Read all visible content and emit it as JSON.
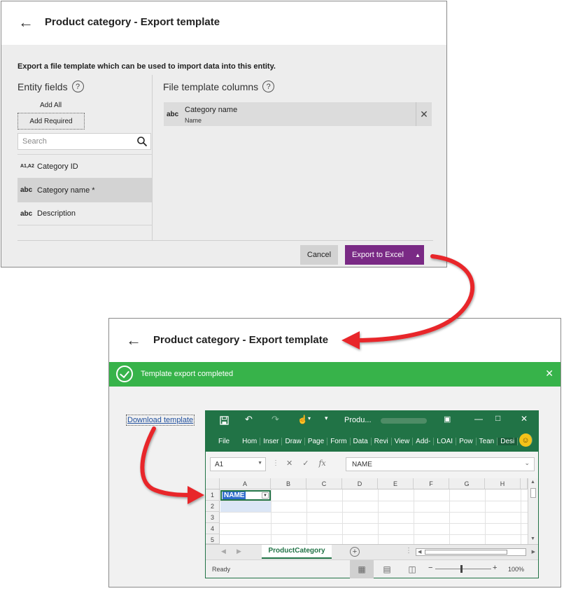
{
  "export_dialog": {
    "title": "Product category - Export template",
    "description": "Export a file template which can be used to import data into this entity.",
    "entity_fields_title": "Entity fields",
    "file_columns_title": "File template columns",
    "help_glyph": "?",
    "add_all_label": "Add All",
    "add_required_label": "Add Required",
    "search_placeholder": "Search",
    "fields": [
      {
        "icon": "A1,A2",
        "label": "Category ID"
      },
      {
        "icon": "abc",
        "label": "Category name *"
      },
      {
        "icon": "abc",
        "label": "Description"
      }
    ],
    "column": {
      "icon": "abc",
      "name": "Category name",
      "sub": "Name"
    },
    "cancel_label": "Cancel",
    "export_label": "Export to Excel"
  },
  "result_dialog": {
    "title": "Product category - Export template",
    "success_message": "Template export completed",
    "download_link": "Download template"
  },
  "excel": {
    "title_short": "Produ...",
    "ribbon_tabs": [
      "File",
      "Hom",
      "Inser",
      "Draw",
      "Page",
      "Form",
      "Data",
      "Revi",
      "View",
      "Add-",
      "LOAI",
      "Pow",
      "Tean",
      "Desi"
    ],
    "name_box": "A1",
    "formula_value": "NAME",
    "columns": [
      "A",
      "B",
      "C",
      "D",
      "E",
      "F",
      "G",
      "H"
    ],
    "rows": [
      "1",
      "2",
      "3",
      "4",
      "5"
    ],
    "cell_a1": "NAME",
    "sheet_name": "ProductCategory",
    "status": "Ready",
    "zoom": "100%"
  },
  "colors": {
    "accent_purple": "#7a2a85",
    "success_green": "#37b34a",
    "excel_green": "#217346",
    "annotation_red": "#e8262b"
  }
}
